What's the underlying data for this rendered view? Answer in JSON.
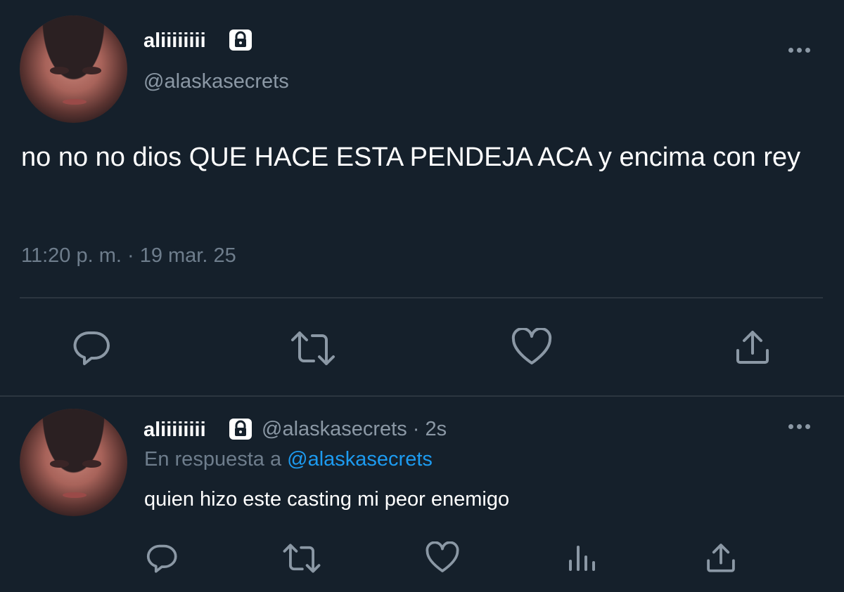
{
  "main_tweet": {
    "display_name": "aliiiiiiii",
    "handle": "@alaskasecrets",
    "text": "no no no dios QUE HACE ESTA PENDEJA ACA y encima con rey",
    "timestamp": "11:20 p. m. · 19 mar. 25",
    "icons": [
      "lock-icon",
      "more-icon",
      "reply-icon",
      "retweet-icon",
      "like-icon",
      "share-icon"
    ]
  },
  "reply_tweet": {
    "display_name": "aliiiiiiii",
    "handle_time": "@alaskasecrets · 2s",
    "reply_prefix": "En respuesta a",
    "reply_mention": "@alaskasecrets",
    "text": "quien hizo este casting mi peor enemigo",
    "icons": [
      "lock-icon",
      "more-icon",
      "reply-icon",
      "retweet-icon",
      "like-icon",
      "analytics-icon",
      "share-icon"
    ]
  },
  "colors": {
    "background": "#15202b",
    "text_primary": "#ffffff",
    "text_secondary": "#8b98a5",
    "text_muted": "#6e7d8c",
    "link": "#1d9bf0",
    "divider": "#2c3640"
  }
}
